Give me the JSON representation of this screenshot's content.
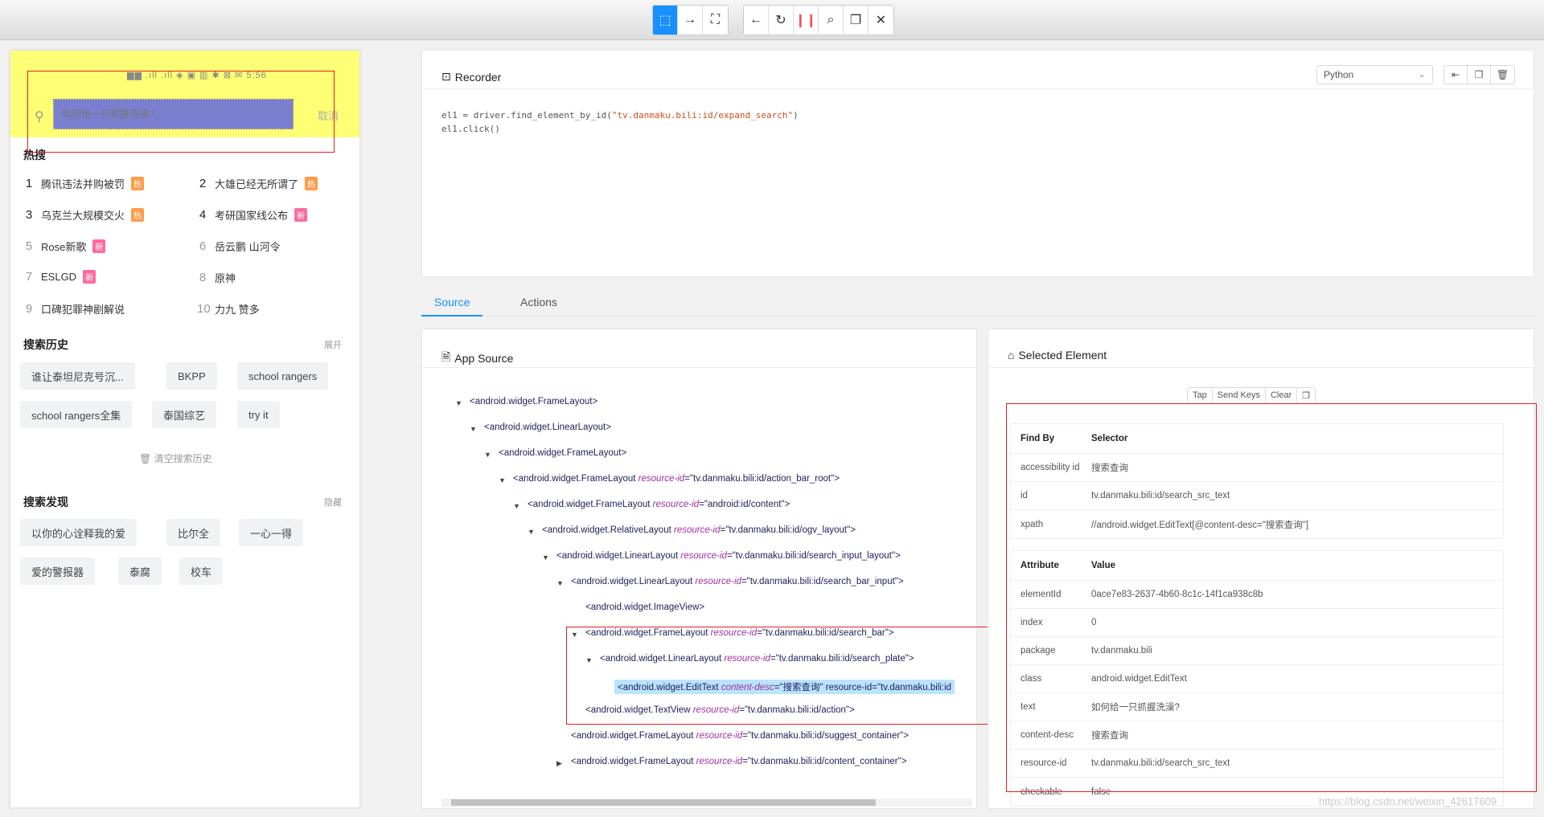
{
  "toolbar": {
    "group1": [
      {
        "icon": "select-icon",
        "glyph": "⬚",
        "active": true
      },
      {
        "icon": "swipe-icon",
        "glyph": "→"
      },
      {
        "icon": "tap-by-coords-icon",
        "glyph": "⛶"
      }
    ],
    "group2": [
      {
        "icon": "back-icon",
        "glyph": "←"
      },
      {
        "icon": "refresh-icon",
        "glyph": "↻"
      },
      {
        "icon": "pause-icon",
        "glyph": "❙❙"
      },
      {
        "icon": "search-icon",
        "glyph": "⌕"
      },
      {
        "icon": "copy-xml-icon",
        "glyph": "❐"
      },
      {
        "icon": "close-icon",
        "glyph": "✕"
      }
    ]
  },
  "phone": {
    "status_icons": "▆▆ .ıll .ıll ◈ ▣  ▥ ✱ ⊠  ✉ 5:56",
    "search_placeholder": "如何给一只抓握洗澡?",
    "cancel": "取消",
    "hot_title": "热搜",
    "hot_items": [
      {
        "rank": "1",
        "text": "腾讯违法并购被罚",
        "tag": "热",
        "tag_type": "hot"
      },
      {
        "rank": "2",
        "text": "大雄已经无所谓了",
        "tag": "热",
        "tag_type": "hot"
      },
      {
        "rank": "3",
        "text": "乌克兰大规模交火",
        "tag": "热",
        "tag_type": "hot"
      },
      {
        "rank": "4",
        "text": "考研国家线公布",
        "tag": "新",
        "tag_type": "new"
      },
      {
        "rank": "5",
        "text": "Rose新歌",
        "tag": "新",
        "tag_type": "new"
      },
      {
        "rank": "6",
        "text": "岳云鹏 山河令",
        "tag": "",
        "tag_type": ""
      },
      {
        "rank": "7",
        "text": "ESLGD",
        "tag": "新",
        "tag_type": "new"
      },
      {
        "rank": "8",
        "text": "原神",
        "tag": "",
        "tag_type": ""
      },
      {
        "rank": "9",
        "text": "口碑犯罪神剧解说",
        "tag": "",
        "tag_type": ""
      },
      {
        "rank": "10",
        "text": "力九 赞多",
        "tag": "",
        "tag_type": ""
      }
    ],
    "history_title": "搜索历史",
    "history_toggle": "展开",
    "history": [
      "谁让泰坦尼克号沉...",
      "BKPP",
      "school rangers",
      "school rangers全集",
      "泰国综艺",
      "try it"
    ],
    "clear_history": "清空搜索历史",
    "discover_title": "搜索发现",
    "discover_toggle": "隐藏",
    "discover": [
      "以你的心诠释我的爱",
      "比尔全",
      "一心一得",
      "爱的警报器",
      "泰腐",
      "校车"
    ]
  },
  "recorder": {
    "title": "Recorder",
    "language": "Python",
    "code_line1_prefix": "el1 = driver.find_element_by_id(",
    "code_line1_str": "\"tv.danmaku.bili:id/expand_search\"",
    "code_line1_suffix": ")",
    "code_line2": "el1.click()"
  },
  "tabs": [
    "Source",
    "Actions"
  ],
  "source": {
    "title": "App Source",
    "nodes": [
      {
        "tag": "<android.widget.FrameLayout>",
        "attr": "",
        "val": "",
        "caret": "▼"
      },
      {
        "tag": "<android.widget.LinearLayout>",
        "attr": "",
        "val": "",
        "caret": "▼"
      },
      {
        "tag": "<android.widget.FrameLayout>",
        "attr": "",
        "val": "",
        "caret": "▼"
      },
      {
        "tag": "<android.widget.FrameLayout ",
        "attr": "resource-id",
        "val": "=\"tv.danmaku.bili:id/action_bar_root\">",
        "caret": "▼"
      },
      {
        "tag": "<android.widget.FrameLayout ",
        "attr": "resource-id",
        "val": "=\"android:id/content\">",
        "caret": "▼"
      },
      {
        "tag": "<android.widget.RelativeLayout ",
        "attr": "resource-id",
        "val": "=\"tv.danmaku.bili:id/ogv_layout\">",
        "caret": "▼"
      },
      {
        "tag": "<android.widget.LinearLayout ",
        "attr": "resource-id",
        "val": "=\"tv.danmaku.bili:id/search_input_layout\">",
        "caret": "▼"
      },
      {
        "tag": "<android.widget.LinearLayout ",
        "attr": "resource-id",
        "val": "=\"tv.danmaku.bili:id/search_bar_input\">",
        "caret": "▼"
      },
      {
        "tag": "<android.widget.ImageView>",
        "attr": "",
        "val": "",
        "caret": ""
      },
      {
        "tag": "<android.widget.FrameLayout ",
        "attr": "resource-id",
        "val": "=\"tv.danmaku.bili:id/search_bar\">",
        "caret": "▼"
      },
      {
        "tag": "<android.widget.LinearLayout ",
        "attr": "resource-id",
        "val": "=\"tv.danmaku.bili:id/search_plate\">",
        "caret": "▼"
      },
      {
        "tag": "<android.widget.EditText ",
        "attr": "content-desc",
        "val": "=\"搜索查询\" resource-id=\"tv.danmaku.bili:id",
        "caret": ""
      },
      {
        "tag": "<android.widget.TextView ",
        "attr": "resource-id",
        "val": "=\"tv.danmaku.bili:id/action\">",
        "caret": ""
      },
      {
        "tag": "<android.widget.FrameLayout ",
        "attr": "resource-id",
        "val": "=\"tv.danmaku.bili:id/suggest_container\">",
        "caret": ""
      },
      {
        "tag": "<android.widget.FrameLayout ",
        "attr": "resource-id",
        "val": "=\"tv.danmaku.bili:id/content_container\">",
        "caret": "▶"
      }
    ]
  },
  "selected": {
    "title": "Selected Element",
    "actions": [
      "Tap",
      "Send Keys",
      "Clear",
      "❐"
    ],
    "find_by_header": [
      "Find By",
      "Selector"
    ],
    "find_by": [
      [
        "accessibility id",
        "搜索查询"
      ],
      [
        "id",
        "tv.danmaku.bili:id/search_src_text"
      ],
      [
        "xpath",
        "//android.widget.EditText[@content-desc=\"搜索查询\"]"
      ]
    ],
    "attr_header": [
      "Attribute",
      "Value"
    ],
    "attributes": [
      [
        "elementId",
        "0ace7e83-2637-4b60-8c1c-14f1ca938c8b"
      ],
      [
        "index",
        "0"
      ],
      [
        "package",
        "tv.danmaku.bili"
      ],
      [
        "class",
        "android.widget.EditText"
      ],
      [
        "text",
        "如何给一只抓握洗澡?"
      ],
      [
        "content-desc",
        "搜索查询"
      ],
      [
        "resource-id",
        "tv.danmaku.bili:id/search_src_text"
      ],
      [
        "checkable",
        "false"
      ]
    ]
  },
  "watermark": "https://blog.csdn.net/weixin_42617609"
}
